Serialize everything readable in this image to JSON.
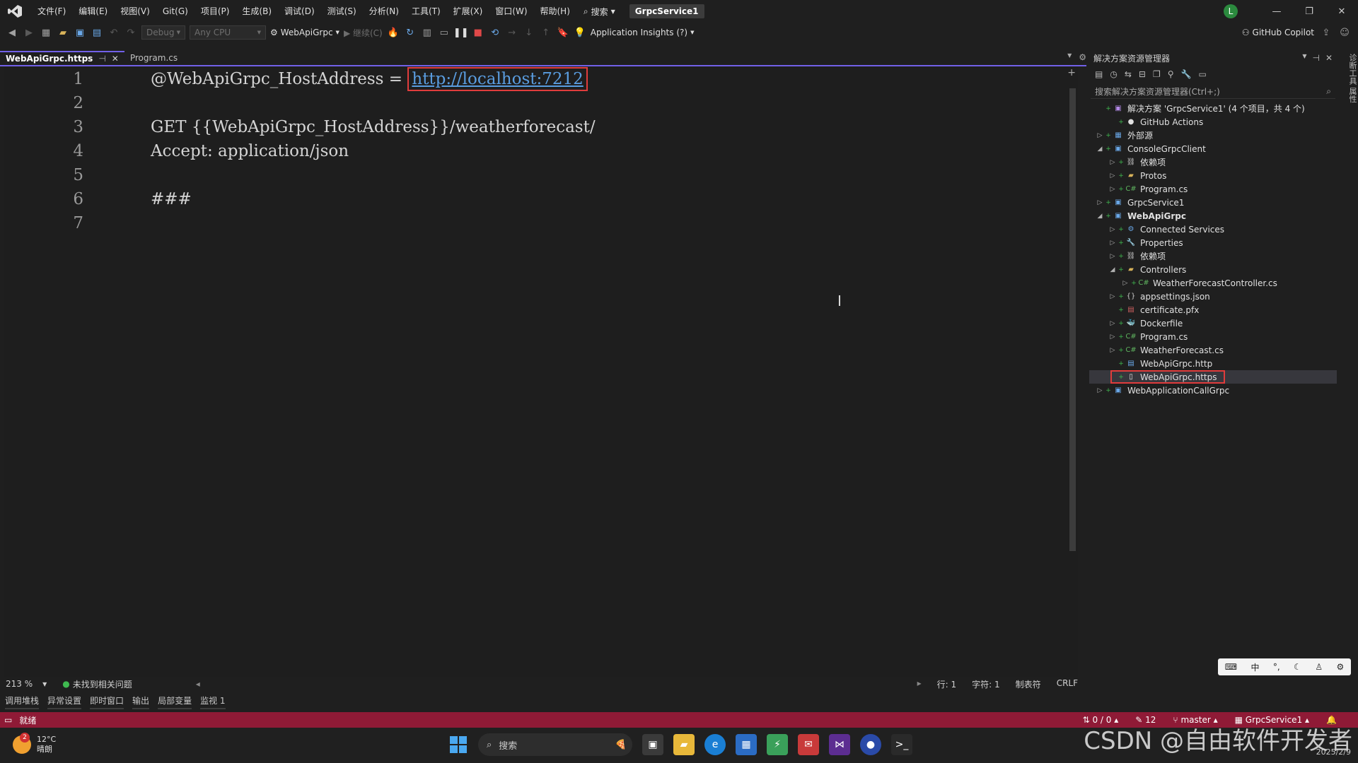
{
  "window": {
    "solution_badge": "GrpcService1",
    "avatar_letter": "L"
  },
  "menu": [
    "文件(F)",
    "编辑(E)",
    "视图(V)",
    "Git(G)",
    "项目(P)",
    "生成(B)",
    "调试(D)",
    "测试(S)",
    "分析(N)",
    "工具(T)",
    "扩展(X)",
    "窗口(W)",
    "帮助(H)"
  ],
  "search": {
    "label": "搜索"
  },
  "toolbar": {
    "config": "Debug",
    "platform": "Any CPU",
    "startup_project": "WebApiGrpc",
    "continue": "继续(C)",
    "app_insights": "Application Insights (?)",
    "copilot": "GitHub Copilot"
  },
  "tabs": [
    {
      "label": "WebApiGrpc.https",
      "active": true
    },
    {
      "label": "Program.cs",
      "active": false
    }
  ],
  "editor": {
    "line_numbers": [
      "1",
      "2",
      "3",
      "4",
      "5",
      "6",
      "7"
    ],
    "lines": {
      "l1_prefix": "@WebApiGrpc_HostAddress = ",
      "l1_url": "http://localhost:7212",
      "l2": "",
      "l3": "GET {{WebApiGrpc_HostAddress}}/weatherforecast/",
      "l4": "Accept: application/json",
      "l5": "",
      "l6": "###",
      "l7": ""
    }
  },
  "editor_status": {
    "zoom": "213 %",
    "issues": "未找到相关问题",
    "line": "行: 1",
    "char": "字符: 1",
    "tabs": "制表符",
    "eol": "CRLF"
  },
  "bottom_tabs": [
    "调用堆栈",
    "异常设置",
    "即时窗口",
    "输出",
    "局部变量",
    "监视 1"
  ],
  "statusbar": {
    "ready": "就绪",
    "sync": "0 / 0",
    "changes": "12",
    "branch": "master",
    "repo": "GrpcService1"
  },
  "solution_explorer": {
    "title": "解决方案资源管理器",
    "search_placeholder": "搜索解决方案资源管理器(Ctrl+;)",
    "items": [
      {
        "label": "解决方案 'GrpcService1' (4 个项目，共 4 个)",
        "depth": 0,
        "arrow": "",
        "icon": "solution-icon"
      },
      {
        "label": "GitHub Actions",
        "depth": 1,
        "arrow": "",
        "icon": "github-icon"
      },
      {
        "label": "外部源",
        "depth": 0,
        "arrow": "▷",
        "icon": "external-source-icon"
      },
      {
        "label": "ConsoleGrpcClient",
        "depth": 0,
        "arrow": "◢",
        "icon": "project-icon"
      },
      {
        "label": "依赖项",
        "depth": 1,
        "arrow": "▷",
        "icon": "dependencies-icon"
      },
      {
        "label": "Protos",
        "depth": 1,
        "arrow": "▷",
        "icon": "folder-icon"
      },
      {
        "label": "Program.cs",
        "depth": 1,
        "arrow": "▷",
        "icon": "csharp-file-icon"
      },
      {
        "label": "GrpcService1",
        "depth": 0,
        "arrow": "▷",
        "icon": "project-icon"
      },
      {
        "label": "WebApiGrpc",
        "depth": 0,
        "arrow": "◢",
        "icon": "project-icon",
        "bold": true
      },
      {
        "label": "Connected Services",
        "depth": 1,
        "arrow": "▷",
        "icon": "connected-services-icon"
      },
      {
        "label": "Properties",
        "depth": 1,
        "arrow": "▷",
        "icon": "properties-icon"
      },
      {
        "label": "依赖项",
        "depth": 1,
        "arrow": "▷",
        "icon": "dependencies-icon"
      },
      {
        "label": "Controllers",
        "depth": 1,
        "arrow": "◢",
        "icon": "folder-icon"
      },
      {
        "label": "WeatherForecastController.cs",
        "depth": 2,
        "arrow": "▷",
        "icon": "csharp-file-icon"
      },
      {
        "label": "appsettings.json",
        "depth": 1,
        "arrow": "▷",
        "icon": "json-file-icon"
      },
      {
        "label": "certificate.pfx",
        "depth": 1,
        "arrow": "",
        "icon": "certificate-icon"
      },
      {
        "label": "Dockerfile",
        "depth": 1,
        "arrow": "▷",
        "icon": "docker-icon"
      },
      {
        "label": "Program.cs",
        "depth": 1,
        "arrow": "▷",
        "icon": "csharp-file-icon"
      },
      {
        "label": "WeatherForecast.cs",
        "depth": 1,
        "arrow": "▷",
        "icon": "csharp-file-icon"
      },
      {
        "label": "WebApiGrpc.http",
        "depth": 1,
        "arrow": "",
        "icon": "http-file-icon"
      },
      {
        "label": "WebApiGrpc.https",
        "depth": 1,
        "arrow": "",
        "icon": "file-icon",
        "selected": true
      },
      {
        "label": "WebApplicationCallGrpc",
        "depth": 0,
        "arrow": "▷",
        "icon": "project-icon"
      }
    ]
  },
  "side_strip": {
    "text": "诊断工具 属性"
  },
  "ime": {
    "mode": "中"
  },
  "taskbar": {
    "weather_badge": "2",
    "temperature": "12°C",
    "condition": "晴朗",
    "search_label": "搜索",
    "date": "2025/2/9"
  },
  "watermark": "CSDN @自由软件开发者",
  "colors": {
    "accent": "#7160e8",
    "statusbar": "#8f1a36",
    "highlight_box": "#e03c3c",
    "url": "#5a9de0"
  }
}
